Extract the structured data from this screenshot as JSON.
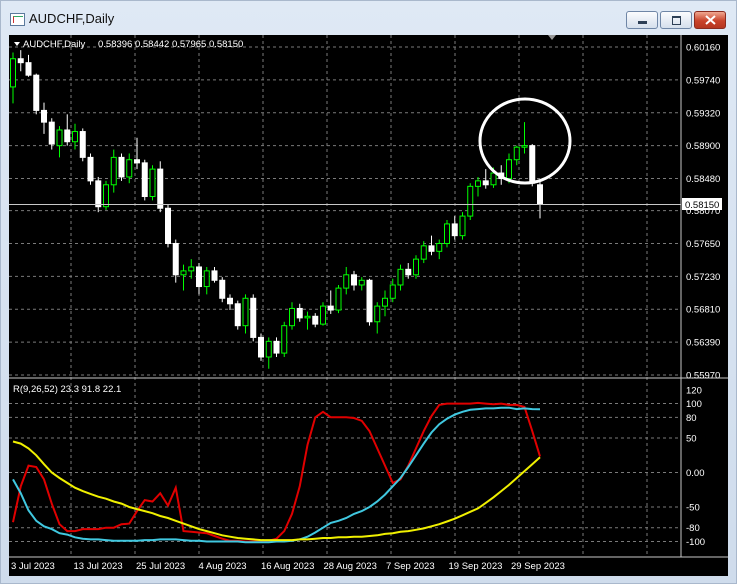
{
  "window": {
    "title": "AUDCHF,Daily"
  },
  "chart_header": {
    "symbol_tf": "AUDCHF,Daily",
    "ohlc": "0.58396 0.58442 0.57965 0.58150"
  },
  "indicator_header": {
    "text": "R(9,26,52) 23.3 91.8 22.1"
  },
  "price_axis": {
    "ticks": [
      "0.60160",
      "0.59740",
      "0.59320",
      "0.58900",
      "0.58480",
      "0.58070",
      "0.57650",
      "0.57230",
      "0.56810",
      "0.56390",
      "0.55970"
    ],
    "current_price": "0.58150"
  },
  "indicator_axis": {
    "ticks": [
      "120",
      "100",
      "80",
      "50",
      "0.00",
      "-50",
      "-80",
      "-100"
    ]
  },
  "date_axis": [
    "3 Jul 2023",
    "13 Jul 2023",
    "25 Jul 2023",
    "4 Aug 2023",
    "16 Aug 2023",
    "28 Aug 2023",
    "7 Sep 2023",
    "19 Sep 2023",
    "29 Sep 2023"
  ],
  "colors": {
    "background": "#000000",
    "bull": "#00ff00",
    "bear": "#ffffff",
    "grid": "#7a7a7a",
    "red_line": "#e00000",
    "cyan_line": "#40c8e0",
    "yellow_line": "#f0f000",
    "annotation": "#ffffff"
  },
  "chart_data": [
    {
      "type": "candlestick",
      "title": "AUDCHF,Daily",
      "ylim": [
        0.5597,
        0.6016
      ],
      "candles": [
        {
          "o": 0.5965,
          "h": 0.6009,
          "l": 0.5944,
          "c": 0.6001
        },
        {
          "o": 0.6001,
          "h": 0.6012,
          "l": 0.5985,
          "c": 0.5996
        },
        {
          "o": 0.5996,
          "h": 0.6006,
          "l": 0.5978,
          "c": 0.598
        },
        {
          "o": 0.598,
          "h": 0.5982,
          "l": 0.593,
          "c": 0.5935
        },
        {
          "o": 0.5935,
          "h": 0.5945,
          "l": 0.5905,
          "c": 0.592
        },
        {
          "o": 0.592,
          "h": 0.5925,
          "l": 0.5885,
          "c": 0.5892
        },
        {
          "o": 0.589,
          "h": 0.5915,
          "l": 0.5875,
          "c": 0.591
        },
        {
          "o": 0.591,
          "h": 0.593,
          "l": 0.589,
          "c": 0.5895
        },
        {
          "o": 0.5895,
          "h": 0.5918,
          "l": 0.5885,
          "c": 0.5908
        },
        {
          "o": 0.5908,
          "h": 0.5912,
          "l": 0.587,
          "c": 0.5875
        },
        {
          "o": 0.5875,
          "h": 0.588,
          "l": 0.584,
          "c": 0.5845
        },
        {
          "o": 0.5845,
          "h": 0.585,
          "l": 0.5805,
          "c": 0.5812
        },
        {
          "o": 0.5812,
          "h": 0.5845,
          "l": 0.5808,
          "c": 0.584
        },
        {
          "o": 0.584,
          "h": 0.5885,
          "l": 0.583,
          "c": 0.5875
        },
        {
          "o": 0.5875,
          "h": 0.588,
          "l": 0.5845,
          "c": 0.585
        },
        {
          "o": 0.585,
          "h": 0.588,
          "l": 0.5842,
          "c": 0.5872
        },
        {
          "o": 0.5872,
          "h": 0.59,
          "l": 0.586,
          "c": 0.5868
        },
        {
          "o": 0.5868,
          "h": 0.5872,
          "l": 0.582,
          "c": 0.5825
        },
        {
          "o": 0.5825,
          "h": 0.5865,
          "l": 0.582,
          "c": 0.586
        },
        {
          "o": 0.586,
          "h": 0.587,
          "l": 0.5805,
          "c": 0.581
        },
        {
          "o": 0.581,
          "h": 0.5815,
          "l": 0.576,
          "c": 0.5765
        },
        {
          "o": 0.5765,
          "h": 0.577,
          "l": 0.5715,
          "c": 0.5725
        },
        {
          "o": 0.5725,
          "h": 0.5738,
          "l": 0.5705,
          "c": 0.573
        },
        {
          "o": 0.573,
          "h": 0.5745,
          "l": 0.572,
          "c": 0.5735
        },
        {
          "o": 0.5735,
          "h": 0.574,
          "l": 0.57,
          "c": 0.571
        },
        {
          "o": 0.571,
          "h": 0.5735,
          "l": 0.57,
          "c": 0.573
        },
        {
          "o": 0.573,
          "h": 0.5735,
          "l": 0.5715,
          "c": 0.5718
        },
        {
          "o": 0.5718,
          "h": 0.5722,
          "l": 0.569,
          "c": 0.5695
        },
        {
          "o": 0.5695,
          "h": 0.57,
          "l": 0.568,
          "c": 0.5688
        },
        {
          "o": 0.5688,
          "h": 0.5692,
          "l": 0.5655,
          "c": 0.566
        },
        {
          "o": 0.566,
          "h": 0.57,
          "l": 0.565,
          "c": 0.5695
        },
        {
          "o": 0.5695,
          "h": 0.57,
          "l": 0.564,
          "c": 0.5645
        },
        {
          "o": 0.5645,
          "h": 0.565,
          "l": 0.5615,
          "c": 0.562
        },
        {
          "o": 0.562,
          "h": 0.5645,
          "l": 0.5605,
          "c": 0.564
        },
        {
          "o": 0.564,
          "h": 0.5645,
          "l": 0.562,
          "c": 0.5625
        },
        {
          "o": 0.5625,
          "h": 0.5665,
          "l": 0.562,
          "c": 0.566
        },
        {
          "o": 0.566,
          "h": 0.569,
          "l": 0.5655,
          "c": 0.5682
        },
        {
          "o": 0.5682,
          "h": 0.5688,
          "l": 0.5665,
          "c": 0.567
        },
        {
          "o": 0.567,
          "h": 0.5678,
          "l": 0.5655,
          "c": 0.5672
        },
        {
          "o": 0.5672,
          "h": 0.5676,
          "l": 0.5658,
          "c": 0.5662
        },
        {
          "o": 0.5662,
          "h": 0.569,
          "l": 0.566,
          "c": 0.5685
        },
        {
          "o": 0.5685,
          "h": 0.5705,
          "l": 0.5675,
          "c": 0.568
        },
        {
          "o": 0.568,
          "h": 0.5712,
          "l": 0.5676,
          "c": 0.5708
        },
        {
          "o": 0.5708,
          "h": 0.5735,
          "l": 0.57,
          "c": 0.5725
        },
        {
          "o": 0.5725,
          "h": 0.573,
          "l": 0.5705,
          "c": 0.5712
        },
        {
          "o": 0.5712,
          "h": 0.5722,
          "l": 0.5705,
          "c": 0.5718
        },
        {
          "o": 0.5718,
          "h": 0.572,
          "l": 0.566,
          "c": 0.5665
        },
        {
          "o": 0.5665,
          "h": 0.569,
          "l": 0.565,
          "c": 0.5685
        },
        {
          "o": 0.5685,
          "h": 0.5705,
          "l": 0.5672,
          "c": 0.5695
        },
        {
          "o": 0.5695,
          "h": 0.572,
          "l": 0.569,
          "c": 0.5712
        },
        {
          "o": 0.5712,
          "h": 0.5738,
          "l": 0.5705,
          "c": 0.5732
        },
        {
          "o": 0.5732,
          "h": 0.574,
          "l": 0.572,
          "c": 0.5725
        },
        {
          "o": 0.5725,
          "h": 0.575,
          "l": 0.572,
          "c": 0.5745
        },
        {
          "o": 0.5745,
          "h": 0.5768,
          "l": 0.574,
          "c": 0.5762
        },
        {
          "o": 0.5762,
          "h": 0.5775,
          "l": 0.575,
          "c": 0.5755
        },
        {
          "o": 0.5755,
          "h": 0.577,
          "l": 0.5745,
          "c": 0.5765
        },
        {
          "o": 0.5765,
          "h": 0.5795,
          "l": 0.576,
          "c": 0.579
        },
        {
          "o": 0.579,
          "h": 0.58,
          "l": 0.577,
          "c": 0.5775
        },
        {
          "o": 0.5775,
          "h": 0.5805,
          "l": 0.577,
          "c": 0.58
        },
        {
          "o": 0.58,
          "h": 0.5842,
          "l": 0.5795,
          "c": 0.5838
        },
        {
          "o": 0.5838,
          "h": 0.585,
          "l": 0.5825,
          "c": 0.5845
        },
        {
          "o": 0.5845,
          "h": 0.586,
          "l": 0.5835,
          "c": 0.584
        },
        {
          "o": 0.584,
          "h": 0.5862,
          "l": 0.5836,
          "c": 0.5855
        },
        {
          "o": 0.5855,
          "h": 0.5865,
          "l": 0.584,
          "c": 0.5848
        },
        {
          "o": 0.5848,
          "h": 0.588,
          "l": 0.5842,
          "c": 0.5872
        },
        {
          "o": 0.5872,
          "h": 0.589,
          "l": 0.5865,
          "c": 0.5888
        },
        {
          "o": 0.5888,
          "h": 0.592,
          "l": 0.588,
          "c": 0.589
        },
        {
          "o": 0.589,
          "h": 0.5892,
          "l": 0.5838,
          "c": 0.5842
        },
        {
          "o": 0.584,
          "h": 0.5844,
          "l": 0.5797,
          "c": 0.5815
        }
      ]
    },
    {
      "type": "line",
      "title": "R(9,26,52) 23.3 91.8 22.1",
      "ylim": [
        -108,
        124
      ],
      "series": [
        {
          "values": [
            -72,
            -20,
            10,
            8,
            -10,
            -45,
            -75,
            -85,
            -85,
            -82,
            -82,
            -82,
            -80,
            -80,
            -75,
            -74,
            -56,
            -40,
            -42,
            -30,
            -48,
            -22,
            -85,
            -86,
            -87,
            -88,
            -92,
            -96,
            -99,
            -99,
            -100,
            -100,
            -99,
            -99,
            -96,
            -85,
            -60,
            -20,
            40,
            80,
            88,
            80,
            80,
            80,
            79,
            75,
            60,
            35,
            10,
            -15,
            -10,
            10,
            35,
            60,
            82,
            98,
            100,
            100,
            100,
            100,
            101,
            100,
            99,
            100,
            98,
            98,
            95,
            60,
            23.3
          ]
        },
        {
          "values": [
            -10,
            -30,
            -55,
            -70,
            -78,
            -82,
            -88,
            -90,
            -94,
            -96,
            -97,
            -97,
            -98,
            -99,
            -99,
            -99,
            -99,
            -98,
            -98,
            -97,
            -97,
            -97,
            -98,
            -99,
            -99,
            -100,
            -100,
            -100,
            -100,
            -100,
            -101,
            -101,
            -101,
            -101,
            -100,
            -100,
            -99,
            -97,
            -93,
            -87,
            -80,
            -73,
            -70,
            -66,
            -60,
            -56,
            -50,
            -42,
            -32,
            -20,
            -8,
            8,
            25,
            42,
            58,
            70,
            78,
            84,
            88,
            91,
            92,
            93,
            93,
            94,
            94,
            92,
            93,
            92,
            91.8
          ]
        },
        {
          "values": [
            45,
            42,
            35,
            25,
            12,
            0,
            -8,
            -15,
            -22,
            -27,
            -31,
            -35,
            -38,
            -42,
            -45,
            -50,
            -53,
            -56,
            -59,
            -63,
            -66,
            -70,
            -74,
            -78,
            -82,
            -85,
            -88,
            -91,
            -93,
            -95,
            -96,
            -97,
            -98,
            -98,
            -98,
            -98,
            -98,
            -97,
            -97,
            -96,
            -95,
            -95,
            -94,
            -94,
            -93,
            -93,
            -92,
            -91,
            -89,
            -88,
            -86,
            -85,
            -83,
            -81,
            -78,
            -75,
            -71,
            -67,
            -62,
            -57,
            -52,
            -44,
            -36,
            -27,
            -18,
            -8,
            2,
            12,
            22.1
          ]
        }
      ]
    }
  ]
}
